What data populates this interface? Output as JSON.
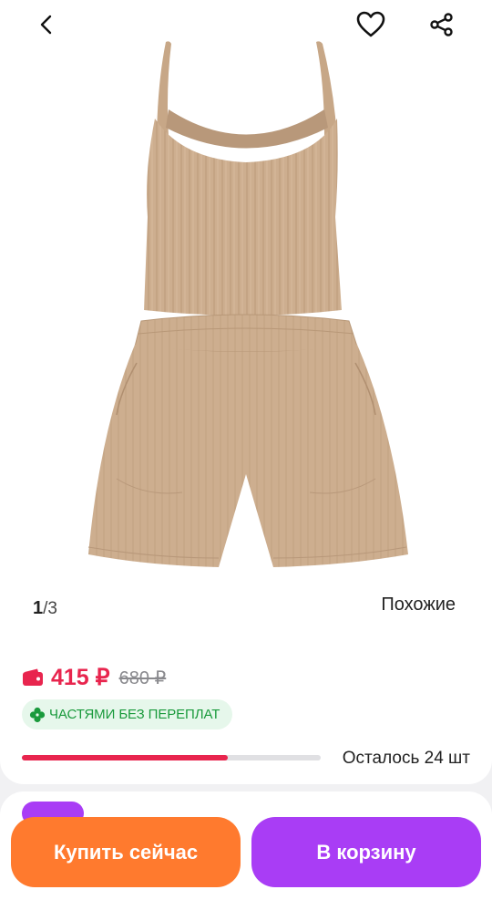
{
  "gallery": {
    "current": "1",
    "separator": "/",
    "total": "3",
    "similar_label": "Похожие"
  },
  "price": {
    "current": "415 ₽",
    "old": "680 ₽"
  },
  "badge": {
    "text": "ЧАСТЯМИ БЕЗ ПЕРЕПЛАТ"
  },
  "stock": {
    "text": "Осталось 24 шт",
    "fill_fraction": 0.69
  },
  "actions": {
    "buy_now": "Купить сейчас",
    "add_to_cart": "В корзину"
  },
  "colors": {
    "price_red": "#e8254e",
    "badge_green": "#1a9a3c",
    "buy_orange": "#ff7a2e",
    "cart_purple": "#a93df5",
    "garment_beige": "#cdae8f"
  },
  "icons": [
    "back-icon",
    "heart-icon",
    "share-icon",
    "wallet-icon",
    "clover-icon"
  ]
}
